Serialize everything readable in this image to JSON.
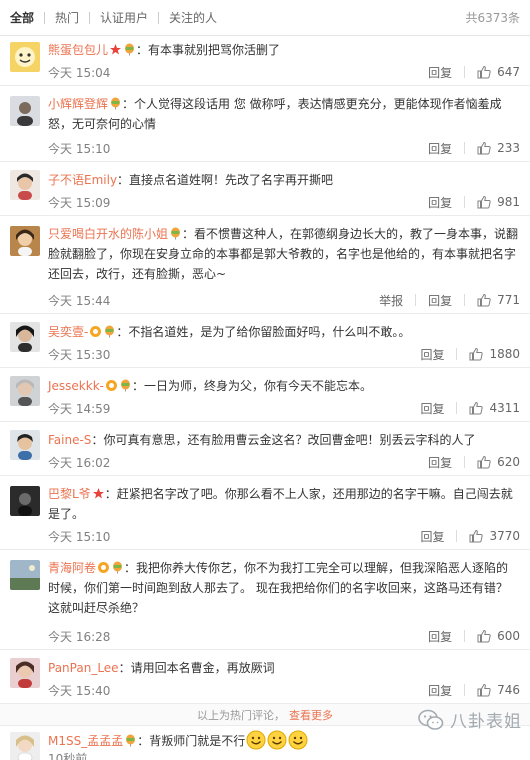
{
  "tabs": [
    {
      "label": "全部"
    },
    {
      "label": "热门"
    },
    {
      "label": "认证用户"
    },
    {
      "label": "关注的人"
    }
  ],
  "total": "共6373条",
  "actions": {
    "reply": "回复",
    "report": "举报"
  },
  "comments": [
    {
      "user": "熊蛋包包儿",
      "text": "：有本事就别把骂你活删了",
      "time": "今天 15:04",
      "likes": "647"
    },
    {
      "user": "小辉辉登辉",
      "text": "：个人觉得这段话用 您 做称呼，表达情感更充分，更能体现作者恼羞成怒，无可奈何的心情",
      "time": "今天 15:10",
      "likes": "233"
    },
    {
      "user": "子不语Emily",
      "text": "：直接点名道姓啊！先改了名字再开撕吧",
      "time": "今天 15:09",
      "likes": "981"
    },
    {
      "user": "只爱喝白开水的陈小姐",
      "text": "：看不惯曹这种人，在郭德纲身边长大的，教了一身本事，说翻脸就翻脸了，你现在安身立命的本事都是郭大爷教的，名字也是他给的，有本事就把名字还回去，改行，还有脸撕，恶心~",
      "time": "今天 15:44",
      "likes": "771"
    },
    {
      "user": "吴奕壹-",
      "text": "：不指名道姓，是为了给你留脸面好吗，什么叫不敢。。",
      "time": "今天 15:30",
      "likes": "1880"
    },
    {
      "user": "Jessekkk-",
      "text": "：一日为师，终身为父，你有今天不能忘本。",
      "time": "今天 14:59",
      "likes": "4311"
    },
    {
      "user": "Faine-S",
      "text": "：你可真有意思，还有脸用曹云金这名？改回曹金吧！别丢云字科的人了",
      "time": "今天 16:02",
      "likes": "620"
    },
    {
      "user": "巴黎L爷",
      "text": "：赶紧把名字改了吧。你那么看不上人家，还用那边的名字干嘛。自己闯去就是了。",
      "time": "今天 15:10",
      "likes": "3770"
    },
    {
      "user": "青海阿卷",
      "text": "：我把你养大传你艺，你不为我打工完全可以理解，但我深陷恶人逐陷的时候，你们第一时间跑到敌人那去了。 现在我把给你们的名字收回来，这路马还有错？ 这就叫赶尽杀绝？",
      "time": "今天 16:28",
      "likes": "600"
    },
    {
      "user": "PanPan_Lee",
      "text": "：请用回本名曹金，再放厥词",
      "time": "今天 15:40",
      "likes": "746"
    }
  ],
  "hot_footer": {
    "text": "以上为热门评论，",
    "link": "查看更多"
  },
  "last_comment": {
    "user": "M1SS_孟孟孟",
    "text": "：背叛师门就是不行",
    "time": "10秒前"
  },
  "watermark": "八卦表姐",
  "colors": {
    "username": "#eb7350",
    "time": "#808080",
    "border": "#ececec"
  }
}
